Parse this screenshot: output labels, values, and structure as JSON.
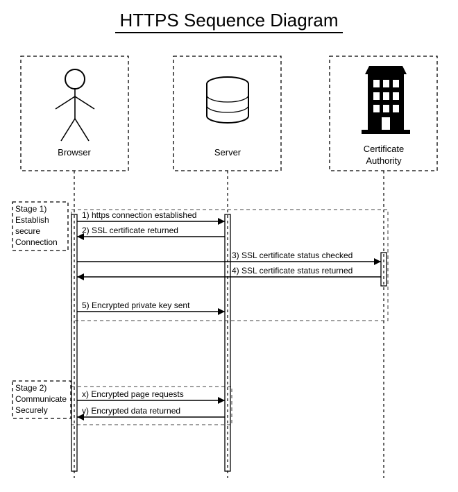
{
  "title": "HTTPS Sequence Diagram",
  "actors": {
    "browser": "Browser",
    "server": "Server",
    "ca_line1": "Certificate",
    "ca_line2": "Authority"
  },
  "stage1": {
    "label_l1": "Stage 1)",
    "label_l2": "Establish",
    "label_l3": "secure",
    "label_l4": "Connection"
  },
  "stage2": {
    "label_l1": "Stage 2)",
    "label_l2": "Communicate",
    "label_l3": "Securely"
  },
  "messages": {
    "m1": "1) https connection established",
    "m2": "2) SSL certificate returned",
    "m3": "3) SSL certificate status checked",
    "m4": "4) SSL certificate status returned",
    "m5": "5) Encrypted private key sent",
    "mx": "x) Encrypted page requests",
    "my": "y) Encrypted data returned"
  }
}
